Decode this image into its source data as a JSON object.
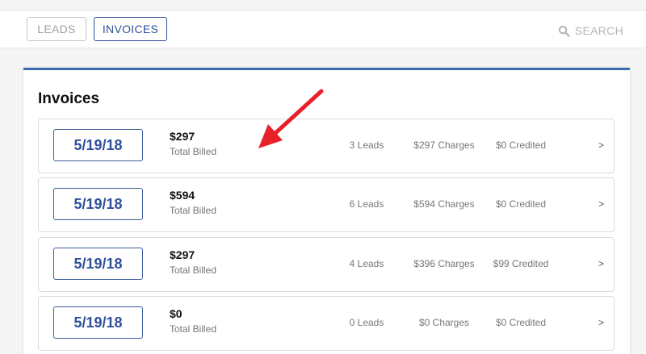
{
  "header": {
    "tabs": [
      {
        "label": "LEADS",
        "active": false
      },
      {
        "label": "INVOICES",
        "active": true
      }
    ],
    "search": {
      "label": "SEARCH",
      "icon": "search-icon"
    }
  },
  "main": {
    "title": "Invoices",
    "invoices": [
      {
        "date": "5/19/18",
        "amount": "$297",
        "amount_label": "Total Billed",
        "leads": "3 Leads",
        "charges": "$297 Charges",
        "credited": "$0 Credited",
        "chevron": ">"
      },
      {
        "date": "5/19/18",
        "amount": "$594",
        "amount_label": "Total Billed",
        "leads": "6 Leads",
        "charges": "$594 Charges",
        "credited": "$0 Credited",
        "chevron": ">"
      },
      {
        "date": "5/19/18",
        "amount": "$297",
        "amount_label": "Total Billed",
        "leads": "4 Leads",
        "charges": "$396 Charges",
        "credited": "$99 Credited",
        "chevron": ">"
      },
      {
        "date": "5/19/18",
        "amount": "$0",
        "amount_label": "Total Billed",
        "leads": "0 Leads",
        "charges": "$0 Charges",
        "credited": "$0 Credited",
        "chevron": ">"
      }
    ]
  },
  "annotation": {
    "icon": "red-arrow-icon",
    "color": "#e8202a"
  },
  "colors": {
    "accent": "#2f4f9a",
    "panel_border": "#3d6caf"
  }
}
